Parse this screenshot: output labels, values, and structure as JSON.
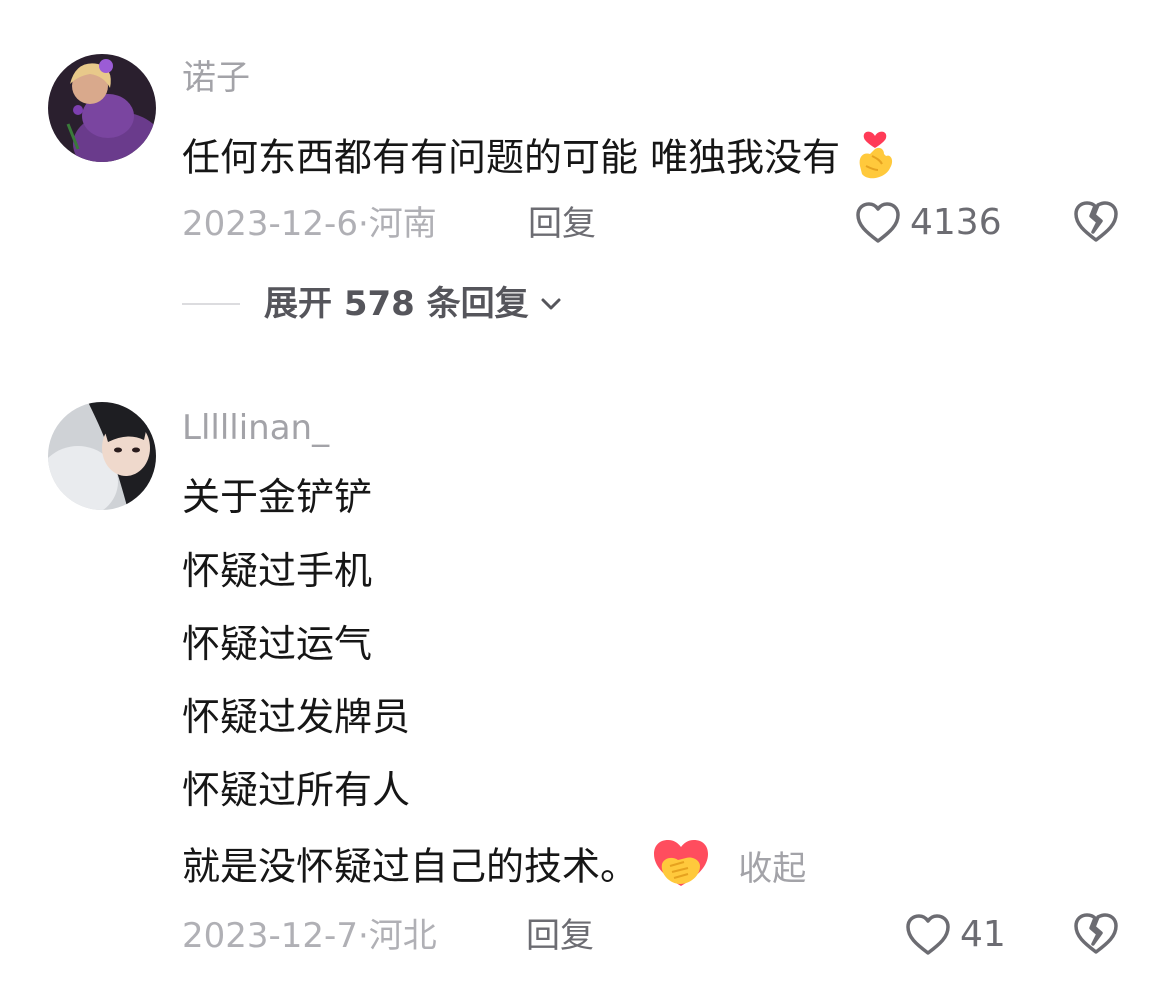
{
  "comments": [
    {
      "username": "诺子",
      "avatar_icon": "avatar-girl-purple-dress",
      "text_lines": [
        "任何东西都有有问题的可能 唯独我没有"
      ],
      "emoji_icon": "finger-heart-emoji",
      "date": "2023-12-6",
      "location": "河南",
      "reply_label": "回复",
      "likes": "4136",
      "expand_label": "展开 578 条回复"
    },
    {
      "username": "Lllllinan_",
      "avatar_icon": "avatar-girl-dark-hair",
      "text_lines": [
        "关于金铲铲",
        "怀疑过手机",
        "怀疑过运气",
        "怀疑过发牌员",
        "怀疑过所有人",
        "就是没怀疑过自己的技术。"
      ],
      "emoji_icon": "heart-hands-emoji",
      "collapse_label": "收起",
      "date": "2023-12-7",
      "location": "河北",
      "reply_label": "回复",
      "likes": "41"
    }
  ],
  "colors": {
    "text_primary": "#161616",
    "text_secondary": "#a3a3a8",
    "action": "#6c6c72"
  }
}
